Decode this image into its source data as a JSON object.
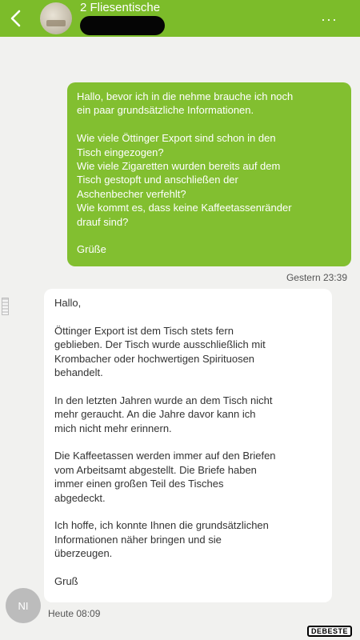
{
  "header": {
    "title": "2 Fliesentische",
    "more_label": "···",
    "accent": "#7cbc2a"
  },
  "outgoing": {
    "lines": [
      "Hallo, bevor ich in die nehme brauche ich noch",
      "ein paar grundsätzliche Informationen.",
      "",
      "Wie viele Öttinger Export sind schon in den",
      "Tisch eingezogen?",
      "Wie viele Zigaretten wurden bereits auf dem",
      "Tisch gestopft und anschließen der",
      "Aschenbecher verfehlt?",
      "Wie kommt es, dass keine Kaffeetassenränder",
      "drauf sind?",
      "",
      "Grüße"
    ],
    "time": "Gestern 23:39",
    "color": "#82bf30"
  },
  "incoming": {
    "lines": [
      "Hallo,",
      "",
      "Öttinger Export ist dem Tisch stets fern",
      "geblieben. Der Tisch wurde ausschließlich mit",
      "Krombacher oder hochwertigen Spirituosen",
      "behandelt.",
      "",
      "In den letzten Jahren wurde an dem Tisch nicht",
      "mehr geraucht. An die Jahre davor kann ich",
      "mich nicht mehr erinnern.",
      "",
      "Die Kaffeetassen werden immer auf den Briefen",
      "vom Arbeitsamt abgestellt. Die Briefe haben",
      "immer einen großen Teil des Tisches",
      "abgedeckt.",
      "",
      "Ich hoffe, ich konnte Ihnen die grundsätzlichen",
      "Informationen näher bringen und sie",
      "überzeugen.",
      "",
      "Gruß"
    ],
    "avatar_initials": "NI",
    "time": "Heute 08:09"
  },
  "watermark": "DEBESTE"
}
